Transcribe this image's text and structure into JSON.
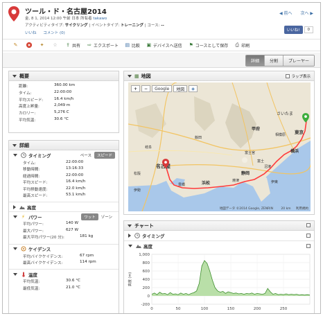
{
  "header": {
    "title": "ツール・ド・名古屋2014",
    "date_line": "金, 8 1, 2014 12:00 午前 日本 所有者",
    "owner": "takawo",
    "activity_type_label": "アクティビティタイプ:",
    "activity_type": "サイクリング",
    "event_type_label": "| イベントタイプ:",
    "event_type": "トレーニング",
    "course_label": "| コース:",
    "course": "--",
    "like_link": "いいね",
    "comment_link": "コメント (0)",
    "prev_link": "◀ 前へ",
    "next_link": "次へ ▶",
    "fb_like": "いいね!",
    "fb_count": "0"
  },
  "toolbar": {
    "share": "共有",
    "export": "エクスポート",
    "compare": "比較",
    "send_device": "デバイスへ送信",
    "save_course": "コースとして保存",
    "print": "印刷"
  },
  "view_tabs": [
    "詳細",
    "分割",
    "プレーヤー"
  ],
  "overview": {
    "title": "概要",
    "rows": [
      {
        "k": "距離:",
        "v": "360.00 km"
      },
      {
        "k": "タイム:",
        "v": "22:00:00"
      },
      {
        "k": "平均スピード:",
        "v": "16.4 km/h"
      },
      {
        "k": "高度上昇量:",
        "v": "2,049 m"
      },
      {
        "k": "カロリー:",
        "v": "5,276 C"
      },
      {
        "k": "平均気温:",
        "v": "30.6 °C"
      }
    ]
  },
  "details": {
    "title": "詳細",
    "timing": {
      "label": "タイミング",
      "toggle_pace": "ペース",
      "toggle_speed": "スピード",
      "rows": [
        {
          "k": "タイム:",
          "v": "22:00:00"
        },
        {
          "k": "移動時間:",
          "v": "13:16:33"
        },
        {
          "k": "経過時間:",
          "v": "22:00:00"
        },
        {
          "k": "平均スピード:",
          "v": "16.4 km/h"
        },
        {
          "k": "平均移動速度:",
          "v": "22.0 km/h"
        },
        {
          "k": "最高スピード:",
          "v": "53.1 km/h"
        }
      ]
    },
    "elevation": {
      "label": "高度"
    },
    "power": {
      "label": "パワー",
      "toggle_watts": "ワット",
      "toggle_zones": "ゾーン",
      "rows": [
        {
          "k": "平均パワー:",
          "v": "140 W"
        },
        {
          "k": "最大パワー:",
          "v": "627 W"
        },
        {
          "k": "最大平均パワー(20 分):",
          "v": "181 kg"
        }
      ]
    },
    "cadence": {
      "label": "ケイデンス",
      "rows": [
        {
          "k": "平均バイクケイデンス:",
          "v": "67 rpm"
        },
        {
          "k": "最高バイクケイデンス:",
          "v": "114 rpm"
        }
      ]
    },
    "temperature": {
      "label": "温度",
      "rows": [
        {
          "k": "平均気温:",
          "v": "30.6 °C"
        },
        {
          "k": "最低気温:",
          "v": "21.0 °C"
        }
      ]
    }
  },
  "map": {
    "title": "地図",
    "lap_display": "ラップ表示",
    "provider": "Google",
    "type": "地図",
    "footer": "地図データ ©2014 Google, ZENRIN",
    "scale": "20 km",
    "terms": "利用規約",
    "labels": [
      "名古屋",
      "静岡",
      "浜松",
      "豊橋",
      "富士宮",
      "富士",
      "甲府",
      "相模原",
      "横浜",
      "さいたま",
      "東京",
      "伊勢",
      "岐阜",
      "飯田",
      "焼津",
      "伊東",
      "沼津",
      "松阪"
    ]
  },
  "chart": {
    "title": "チャート",
    "timing_label": "タイミング",
    "elevation_label": "高度"
  },
  "colors": {
    "accent": "#3a6ea5",
    "chart_line": "#3f8f2f",
    "chart_fill": "#b9dfa8",
    "map_route": "#ff3b3b",
    "pin": "#d83a3a"
  },
  "chart_data": {
    "type": "area",
    "title": "",
    "xlabel": "",
    "ylabel": "高度 (m)",
    "xlim": [
      0,
      300
    ],
    "ylim": [
      -200,
      1000
    ],
    "yticks": [
      -200,
      0,
      200,
      400,
      600,
      800,
      1000
    ],
    "xticks": [
      0,
      50,
      100,
      150,
      200,
      250
    ],
    "x": [
      0,
      5,
      10,
      15,
      20,
      25,
      30,
      35,
      40,
      45,
      50,
      55,
      60,
      65,
      70,
      75,
      80,
      85,
      90,
      95,
      100,
      105,
      110,
      115,
      120,
      125,
      130,
      135,
      140,
      145,
      150,
      155,
      160,
      165,
      170,
      175,
      180,
      185,
      190,
      195,
      200,
      205,
      210,
      215,
      220,
      225,
      230,
      235,
      240,
      245,
      250,
      255,
      260,
      265,
      270,
      275,
      280,
      285,
      290,
      295,
      300
    ],
    "y": [
      40,
      70,
      30,
      90,
      50,
      60,
      30,
      80,
      40,
      50,
      30,
      70,
      40,
      60,
      30,
      60,
      80,
      120,
      300,
      720,
      850,
      780,
      600,
      380,
      200,
      120,
      90,
      110,
      60,
      100,
      80,
      60,
      70,
      50,
      60,
      40,
      60,
      50,
      70,
      40,
      60,
      50,
      40,
      60,
      180,
      100,
      40,
      60,
      30,
      40,
      30,
      50,
      30,
      40,
      30,
      40,
      20,
      30,
      20,
      30,
      20
    ]
  }
}
